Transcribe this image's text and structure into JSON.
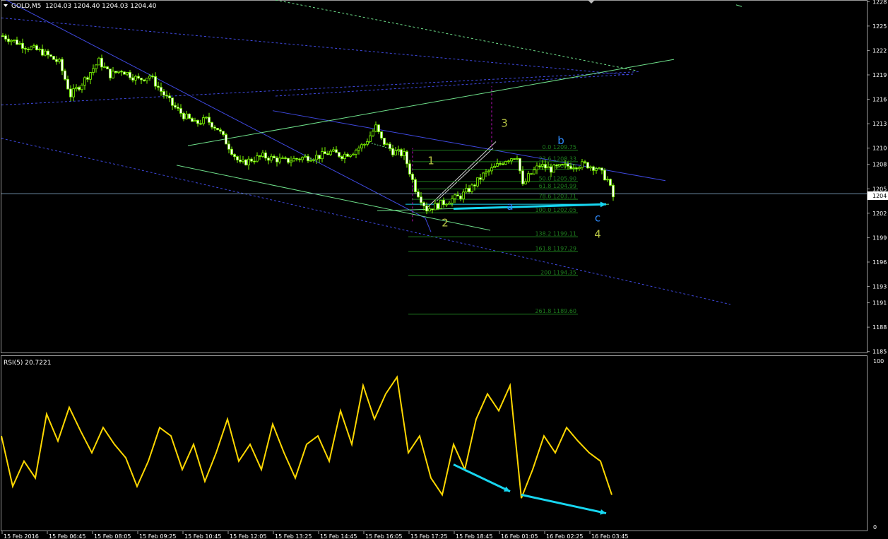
{
  "header": {
    "symbol": "GOLD,M5",
    "ohlc": "1204.03 1204.40 1204.03 1204.40",
    "current_price": "1204"
  },
  "rsi_panel": {
    "label": "RSI(5) 20.7221",
    "scale_top": "100",
    "scale_bottom": "0"
  },
  "colors": {
    "background": "#000000",
    "candle": "#7CFC00",
    "channel_blue": "#3f49e0",
    "channel_green": "#6ee08a",
    "fib": "#1e7d1e",
    "rsi": "#ffd800",
    "arrow": "#17d6f0",
    "wave_yellow": "#b5c244",
    "wave_blue": "#2f8cff",
    "magenta": "#c010c0"
  },
  "chart_data": [
    {
      "type": "candlestick",
      "symbol": "GOLD,M5",
      "ylim": [
        1184.8,
        1228.2
      ],
      "y_ticks": [
        1228,
        1225,
        1222,
        1219,
        1216,
        1213,
        1210,
        1208,
        1205,
        1202,
        1199,
        1196,
        1193,
        1191,
        1188,
        1185
      ],
      "x_ticks": [
        "15 Feb 2016",
        "15 Feb 06:45",
        "15 Feb 08:05",
        "15 Feb 09:25",
        "15 Feb 10:45",
        "15 Feb 12:05",
        "15 Feb 13:25",
        "15 Feb 14:45",
        "15 Feb 16:05",
        "15 Feb 17:25",
        "15 Feb 18:45",
        "16 Feb 01:05",
        "16 Feb 02:25",
        "16 Feb 03:45"
      ],
      "close_path": [
        [
          0,
          1223.8
        ],
        [
          8,
          1222.5
        ],
        [
          14,
          1221.8
        ],
        [
          20,
          1220.5
        ],
        [
          24,
          1216.5
        ],
        [
          28,
          1218.0
        ],
        [
          34,
          1220.7
        ],
        [
          38,
          1219.0
        ],
        [
          42,
          1219.6
        ],
        [
          48,
          1218.4
        ],
        [
          52,
          1218.9
        ],
        [
          56,
          1217.0
        ],
        [
          60,
          1215.3
        ],
        [
          64,
          1214.0
        ],
        [
          68,
          1213.0
        ],
        [
          72,
          1213.5
        ],
        [
          76,
          1212.4
        ],
        [
          80,
          1210.2
        ],
        [
          84,
          1208.0
        ],
        [
          88,
          1208.6
        ],
        [
          92,
          1209.0
        ],
        [
          96,
          1208.7
        ],
        [
          100,
          1208.4
        ],
        [
          104,
          1208.7
        ],
        [
          108,
          1208.9
        ],
        [
          112,
          1209.0
        ],
        [
          116,
          1209.5
        ],
        [
          120,
          1209.1
        ],
        [
          124,
          1209.6
        ],
        [
          128,
          1210.5
        ],
        [
          132,
          1212.6
        ],
        [
          134,
          1211.0
        ],
        [
          138,
          1209.6
        ],
        [
          142,
          1209.2
        ],
        [
          146,
          1205.0
        ],
        [
          150,
          1202.5
        ],
        [
          154,
          1203.0
        ],
        [
          158,
          1203.6
        ],
        [
          162,
          1204.1
        ],
        [
          166,
          1205.2
        ],
        [
          170,
          1206.7
        ],
        [
          174,
          1207.6
        ],
        [
          178,
          1208.6
        ],
        [
          182,
          1209.1
        ],
        [
          184,
          1205.3
        ],
        [
          186,
          1206.5
        ],
        [
          190,
          1207.9
        ],
        [
          194,
          1207.4
        ],
        [
          198,
          1207.7
        ],
        [
          202,
          1207.9
        ],
        [
          206,
          1208.0
        ],
        [
          210,
          1207.6
        ],
        [
          214,
          1206.1
        ],
        [
          216,
          1204.0
        ]
      ],
      "horizontal_line": 1204.4,
      "fibonacci": [
        {
          "label": "0.0",
          "value": 1209.75
        },
        {
          "label": "23.6",
          "value": 1208.33
        },
        {
          "label": "38.2",
          "value": 1207.4
        },
        {
          "label": "50.0",
          "value": 1205.9
        },
        {
          "label": "61.8",
          "value": 1204.99
        },
        {
          "label": "78.6",
          "value": 1203.71
        },
        {
          "label": "100.0",
          "value": 1202.05
        },
        {
          "label": "138.2",
          "value": 1199.11
        },
        {
          "label": "161.8",
          "value": 1197.29
        },
        {
          "label": "200",
          "value": 1194.35
        },
        {
          "label": "261.8",
          "value": 1189.6
        }
      ],
      "wave_labels": [
        {
          "text": "1",
          "x": 152,
          "y": 1208.0,
          "color": "yellow"
        },
        {
          "text": "2",
          "x": 157,
          "y": 1200.4,
          "color": "yellow"
        },
        {
          "text": "3",
          "x": 178,
          "y": 1212.6,
          "color": "yellow"
        },
        {
          "text": "4",
          "x": 211,
          "y": 1199.0,
          "color": "yellow"
        },
        {
          "text": "a",
          "x": 180,
          "y": 1202.4,
          "color": "blue"
        },
        {
          "text": "b",
          "x": 198,
          "y": 1210.5,
          "color": "blue"
        },
        {
          "text": "c",
          "x": 211,
          "y": 1201.0,
          "color": "blue"
        }
      ]
    },
    {
      "type": "line",
      "name": "RSI(5)",
      "ylim": [
        0,
        100
      ],
      "last_value": 20.7221,
      "x": [
        0,
        4,
        8,
        12,
        16,
        20,
        24,
        28,
        32,
        36,
        40,
        44,
        48,
        52,
        56,
        60,
        64,
        68,
        72,
        76,
        80,
        84,
        88,
        92,
        96,
        100,
        104,
        108,
        112,
        116,
        120,
        124,
        128,
        132,
        136,
        140,
        144,
        148,
        152,
        156,
        160,
        164,
        168,
        172,
        176,
        180,
        184,
        188,
        192,
        196,
        200,
        204,
        208,
        212,
        216
      ],
      "values": [
        55,
        25,
        40,
        30,
        68,
        52,
        72,
        58,
        45,
        60,
        50,
        42,
        25,
        40,
        60,
        55,
        35,
        50,
        28,
        45,
        65,
        40,
        50,
        35,
        62,
        45,
        30,
        50,
        55,
        40,
        70,
        50,
        85,
        65,
        80,
        90,
        45,
        55,
        30,
        20,
        50,
        35,
        65,
        80,
        70,
        85,
        18,
        35,
        55,
        45,
        60,
        52,
        45,
        40,
        20
      ]
    }
  ],
  "arrows": [
    {
      "panel": "price",
      "from": [
        160,
        1202.55
      ],
      "to": [
        214,
        1203.1
      ]
    },
    {
      "panel": "rsi",
      "from": [
        160,
        38
      ],
      "to": [
        180,
        22
      ]
    },
    {
      "panel": "rsi",
      "from": [
        184,
        20
      ],
      "to": [
        214,
        9
      ]
    }
  ]
}
